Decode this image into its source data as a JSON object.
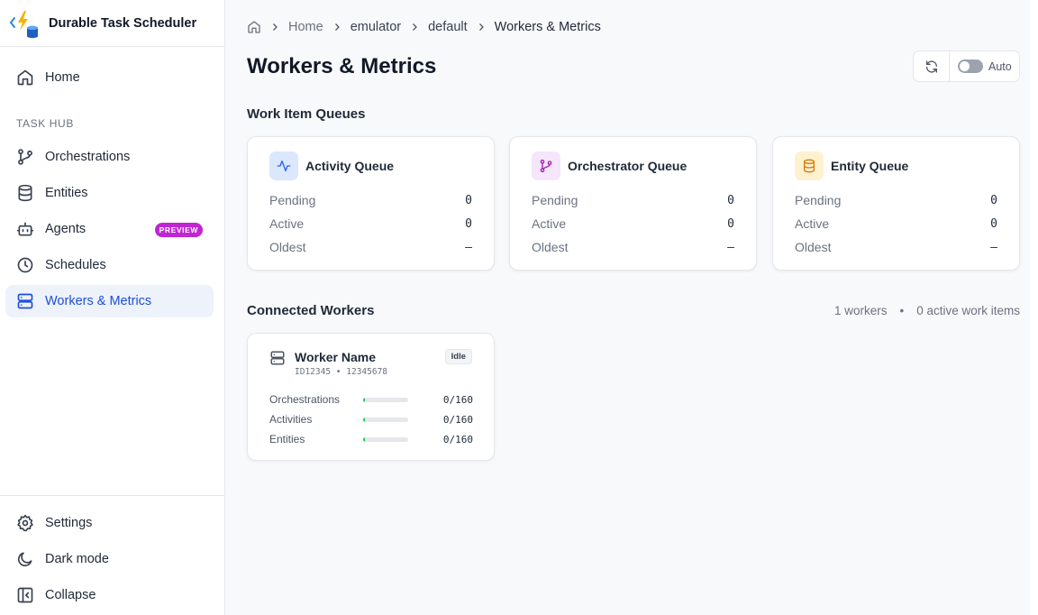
{
  "app": {
    "title": "Durable Task Scheduler"
  },
  "sidebar": {
    "home_label": "Home",
    "section_label": "TASK HUB",
    "items": [
      {
        "label": "Orchestrations",
        "icon": "git-branch-icon"
      },
      {
        "label": "Entities",
        "icon": "database-icon"
      },
      {
        "label": "Agents",
        "icon": "bot-icon",
        "badge": "PREVIEW"
      },
      {
        "label": "Schedules",
        "icon": "clock-icon"
      },
      {
        "label": "Workers & Metrics",
        "icon": "server-icon",
        "active": true
      }
    ],
    "footer": [
      {
        "label": "Settings",
        "icon": "gear-icon"
      },
      {
        "label": "Dark mode",
        "icon": "moon-icon"
      },
      {
        "label": "Collapse",
        "icon": "collapse-icon"
      }
    ]
  },
  "breadcrumb": [
    "Home",
    "emulator",
    "default",
    "Workers & Metrics"
  ],
  "page": {
    "title": "Workers & Metrics"
  },
  "toolbar": {
    "auto_label": "Auto",
    "auto_enabled": false
  },
  "queues": {
    "section_title": "Work Item Queues",
    "cards": [
      {
        "name": "Activity Queue",
        "icon": "activity-pulse-icon",
        "accent": "#2563eb",
        "bg": "#dbe7fd",
        "rows": [
          {
            "label": "Pending",
            "value": "0"
          },
          {
            "label": "Active",
            "value": "0"
          },
          {
            "label": "Oldest",
            "value": "—"
          }
        ]
      },
      {
        "name": "Orchestrator Queue",
        "icon": "git-branch-icon",
        "accent": "#a21caf",
        "bg": "#f5e6fb",
        "rows": [
          {
            "label": "Pending",
            "value": "0"
          },
          {
            "label": "Active",
            "value": "0"
          },
          {
            "label": "Oldest",
            "value": "—"
          }
        ]
      },
      {
        "name": "Entity Queue",
        "icon": "database-icon",
        "accent": "#d97706",
        "bg": "#fdf1cf",
        "rows": [
          {
            "label": "Pending",
            "value": "0"
          },
          {
            "label": "Active",
            "value": "0"
          },
          {
            "label": "Oldest",
            "value": "—"
          }
        ]
      }
    ]
  },
  "workers": {
    "section_title": "Connected Workers",
    "summary_count": "1 workers",
    "summary_dot": "•",
    "summary_active": "0 active work items",
    "list": [
      {
        "name": "Worker Name",
        "id": "ID12345",
        "id_sep": "•",
        "pid": "12345678",
        "status": "Idle",
        "capacity": [
          {
            "label": "Orchestrations",
            "value": "0/160",
            "fraction": 0.0
          },
          {
            "label": "Activities",
            "value": "0/160",
            "fraction": 0.0
          },
          {
            "label": "Entities",
            "value": "0/160",
            "fraction": 0.0
          }
        ]
      }
    ]
  },
  "colors": {
    "active_nav": "#1d4ed8",
    "active_nav_bg": "#eef2fb",
    "preview_badge": "#c026d3",
    "capacity_fill": "#22c55e"
  }
}
